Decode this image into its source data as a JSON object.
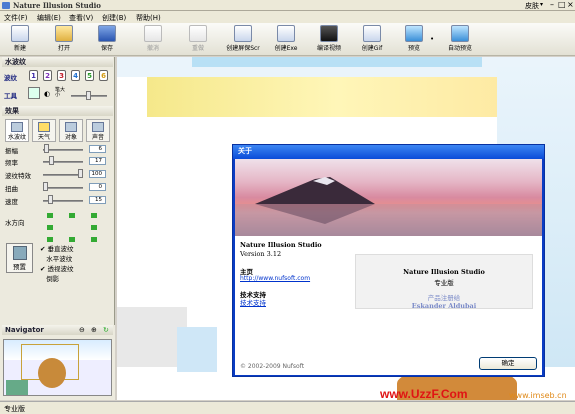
{
  "app": {
    "title": "Nature Illusion Studio",
    "skin_label": "皮肤"
  },
  "menu": [
    "文件(F)",
    "编辑(E)",
    "查看(V)",
    "创建(B)",
    "帮助(H)"
  ],
  "toolbar": {
    "new": "新建",
    "open": "打开",
    "save": "保存",
    "undo": "撤消",
    "redo": "重做",
    "create_screensaver": "创建屏保Scr",
    "create_exe": "创建Exe",
    "create_video": "编译视频",
    "create_gif": "创建Gif",
    "preview": "预览",
    "auto_preview": "自动预览"
  },
  "left": {
    "water_wave_header": "水波纹",
    "wave_label": "波纹",
    "wave_numbers": [
      "1",
      "2",
      "3",
      "4",
      "5",
      "6"
    ],
    "wave_colors": [
      "#3b2aa8",
      "#7b2fb7",
      "#c21f2a",
      "#1c6fd0",
      "#2a9a2a",
      "#d29a14"
    ],
    "tools_label": "工具",
    "brush_size_label": "笔大小",
    "effects_header": "效果",
    "tabs": [
      "水波纹",
      "天气",
      "对象",
      "声音"
    ],
    "params": [
      {
        "label": "振幅",
        "value": "6",
        "level": 0.05
      },
      {
        "label": "频率",
        "value": "17",
        "level": 0.17
      },
      {
        "label": "波纹特效",
        "value": "100",
        "level": 1.0
      },
      {
        "label": "扭曲",
        "value": "0",
        "level": 0.0
      },
      {
        "label": "速度",
        "value": "15",
        "level": 0.15
      }
    ],
    "direction_label": "水方向",
    "preset_label": "预置",
    "checks": [
      {
        "label": "垂直波纹",
        "checked": true
      },
      {
        "label": "水平波纹",
        "checked": false
      },
      {
        "label": "透视波纹",
        "checked": true
      },
      {
        "label": "倒影",
        "checked": false
      }
    ],
    "navigator_label": "Navigator"
  },
  "dialog": {
    "title": "关于",
    "app_name": "Nature Illusion Studio",
    "version": "Version 3.12",
    "homepage_label": "主页",
    "homepage_url": "http://www.nufsoft.com",
    "support_label": "技术支持",
    "support_link": "技术支持",
    "product_name": "Nature Illusion Studio",
    "edition": "专业版",
    "registered_to_label": "产品注册给",
    "registered_to": "Eskander Aldubai",
    "copyright": "© 2002-2009 Nufsoft",
    "ok": "确定"
  },
  "status": {
    "edition": "专业版"
  },
  "watermarks": {
    "uzzf": "www.UzzF.Com",
    "imseb": "www.imseb.cn"
  }
}
